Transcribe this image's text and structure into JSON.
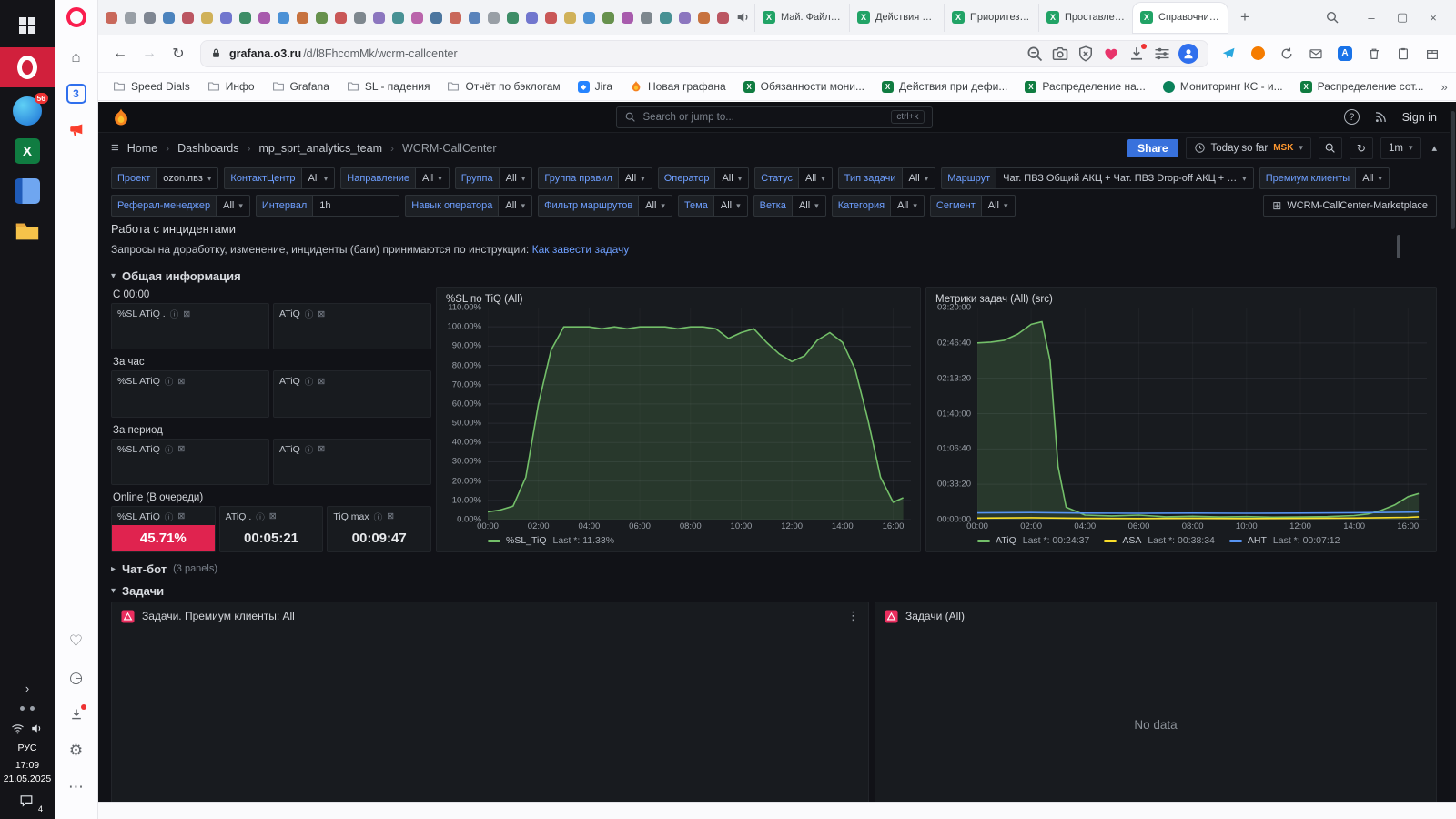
{
  "icons": {
    "chevron_down": "▾",
    "chevron_right": "▸",
    "chevron_up": "▴",
    "kebab": "⋮",
    "crumb_sep": "›",
    "plus": "+",
    "back": "←",
    "forward": "→",
    "reload": "↻",
    "menu": "≡",
    "info": "ⓘ",
    "link_box": "⊠",
    "close": "×",
    "minimize": "–",
    "maximize": "▢",
    "grid": "⊞",
    "more": "»",
    "home": "⌂",
    "heart": "♡",
    "history": "◷",
    "gear": "⚙",
    "ellipsis": "⋯",
    "doc_x": "X",
    "question": "?",
    "tray_expand": "›"
  },
  "taskbar": {
    "time": "17:09",
    "date": "21.05.2025",
    "lang": "РУС",
    "opera_badge": "56",
    "notif_count": "4"
  },
  "opera_sidebar": {
    "tab_count": "3"
  },
  "browser": {
    "pinned_tab_colors": [
      "#c24f3f",
      "#8a8f98",
      "#6b7280",
      "#2f6fb3",
      "#b23a48",
      "#caa53d",
      "#5b5fc7",
      "#1f7a4d",
      "#9b3fa0",
      "#2f7fd0",
      "#c05a1f",
      "#4f7f2f",
      "#c23b3b",
      "#6a737b",
      "#7a5fb5",
      "#2a7f82",
      "#b04a9e",
      "#2f5f8f",
      "#c24f3f",
      "#3f6fb0",
      "#8a8f98",
      "#1f7a4d",
      "#5b5fc7",
      "#c23b3b",
      "#caa53d",
      "#2f7fd0",
      "#4f7f2f",
      "#9b3fa0",
      "#6a737b",
      "#2a7f82",
      "#7a5fb5",
      "#c05a1f",
      "#b23a48"
    ],
    "tabs": [
      {
        "label": "Май. Файл мо...",
        "color": "#21a366"
      },
      {
        "label": "Действия по ...",
        "color": "#21a366"
      },
      {
        "label": "Приоритеза...",
        "color": "#21a366"
      },
      {
        "label": "Проставлени...",
        "color": "#21a366"
      },
      {
        "label": "Справочник ...",
        "color": "#21a366"
      }
    ],
    "active_tab": 4,
    "url_domain": "grafana.o3.ru",
    "url_path": "/d/l8FhcomMk/wcrm-callcenter",
    "bookmarks": [
      {
        "label": "Speed Dials",
        "icon": "folder"
      },
      {
        "label": "Инфо",
        "icon": "folder"
      },
      {
        "label": "Grafana",
        "icon": "folder"
      },
      {
        "label": "SL - падения",
        "icon": "folder"
      },
      {
        "label": "Отчёт по бэклогам",
        "icon": "folder"
      },
      {
        "label": "Jira",
        "icon": "jira"
      },
      {
        "label": "Новая графана",
        "icon": "grafana"
      },
      {
        "label": "Обязанности мони...",
        "icon": "excel"
      },
      {
        "label": "Действия при дефи...",
        "icon": "excel"
      },
      {
        "label": "Распределение на...",
        "icon": "excel"
      },
      {
        "label": "Мониторинг КС - и...",
        "icon": "sharepoint"
      },
      {
        "label": "Распределение сот...",
        "icon": "excel"
      }
    ],
    "extensions": [
      {
        "name": "telegram-extension",
        "kind": "plane",
        "color": "#2aa7de"
      },
      {
        "name": "orange-extension",
        "kind": "dot",
        "color": "#f57c00"
      },
      {
        "name": "sync-extension",
        "kind": "sync"
      },
      {
        "name": "mail-extension",
        "kind": "mail"
      },
      {
        "name": "translate-extension",
        "kind": "badge",
        "color": "#1a73e8",
        "letter": "A"
      },
      {
        "name": "trash-extension",
        "kind": "trash"
      },
      {
        "name": "notes-extension",
        "kind": "clipboard"
      },
      {
        "name": "box-extension",
        "kind": "box"
      }
    ]
  },
  "grafana": {
    "search": {
      "placeholder": "Search or jump to...",
      "shortcut": "ctrl+k"
    },
    "signin_label": "Sign in",
    "breadcrumb": [
      "Home",
      "Dashboards",
      "mp_sprt_analytics_team",
      "WCRM-CallCenter"
    ],
    "share_label": "Share",
    "time_range": "Today so far",
    "timezone": "MSK",
    "refresh": "1m",
    "filters_row1": [
      {
        "label": "Проект",
        "value": "ozon.пвз"
      },
      {
        "label": "КонтактЦентр",
        "value": "All"
      },
      {
        "label": "Направление",
        "value": "All"
      },
      {
        "label": "Группа",
        "value": "All"
      },
      {
        "label": "Группа правил",
        "value": "All"
      },
      {
        "label": "Оператор",
        "value": "All"
      },
      {
        "label": "Статус",
        "value": "All"
      },
      {
        "label": "Тип задачи",
        "value": "All"
      },
      {
        "label": "Маршрут",
        "value": "Чат. ПВЗ Общий АКЦ + Чат. ПВЗ Drop-off АКЦ + Чат. ПВЗ АПВЗ-...",
        "wide": true
      },
      {
        "label": "Премиум клиенты",
        "value": "All"
      }
    ],
    "filters_row2": [
      {
        "label": "Реферал-менеджер",
        "value": "All"
      },
      {
        "label": "Интервал",
        "value": "1h",
        "input": true
      },
      {
        "label": "Навык оператора",
        "value": "All"
      },
      {
        "label": "Фильтр маршрутов",
        "value": "All"
      },
      {
        "label": "Тема",
        "value": "All"
      },
      {
        "label": "Ветка",
        "value": "All"
      },
      {
        "label": "Категория",
        "value": "All"
      },
      {
        "label": "Сегмент",
        "value": "All"
      }
    ],
    "marketplace_label": "WCRM-CallCenter-Marketplace",
    "incident": {
      "title": "Работа с инцидентами",
      "text": "Запросы на доработку, изменение, инциденты (баги) принимаются по инструкции: ",
      "link": "Как завести задачу"
    },
    "sections": {
      "general": "Общая информация",
      "chatbot": "Чат-бот",
      "chatbot_count": "(3 panels)",
      "tasks": "Задачи"
    },
    "stat_groups": [
      {
        "title": "С 00:00",
        "stats": [
          {
            "title": "%SL ATiQ .",
            "value": ""
          },
          {
            "title": "ATiQ",
            "value": ""
          }
        ]
      },
      {
        "title": "За час",
        "stats": [
          {
            "title": "%SL ATiQ",
            "value": ""
          },
          {
            "title": "ATiQ",
            "value": ""
          }
        ]
      },
      {
        "title": "За период",
        "stats": [
          {
            "title": "%SL ATiQ",
            "value": ""
          },
          {
            "title": "ATiQ",
            "value": ""
          }
        ]
      },
      {
        "title": "Online (В очереди)",
        "stats": [
          {
            "title": "%SL ATiQ",
            "value": "45.71%",
            "bg": "#e0234f"
          },
          {
            "title": "ATiQ .",
            "value": "00:05:21"
          },
          {
            "title": "TiQ max",
            "value": "00:09:47"
          }
        ]
      }
    ],
    "panels_bottom": [
      {
        "title": "Задачи. Премиум клиенты: All",
        "body": ""
      },
      {
        "title": "Задачи (All)",
        "body": "No data"
      }
    ]
  },
  "chart_data": [
    {
      "type": "area",
      "title": "%SL по TiQ (All)",
      "xlim": [
        0,
        16.7
      ],
      "ylim": [
        0,
        110
      ],
      "yticks": [
        "110.00%",
        "100.00%",
        "90.00%",
        "80.00%",
        "70.00%",
        "60.00%",
        "50.00%",
        "40.00%",
        "30.00%",
        "20.00%",
        "10.00%",
        "0.00%"
      ],
      "xtick_hours": [
        0,
        2,
        4,
        6,
        8,
        10,
        12,
        14,
        16
      ],
      "xtick_labels": [
        "00:00",
        "02:00",
        "04:00",
        "06:00",
        "08:00",
        "10:00",
        "12:00",
        "14:00",
        "16:00"
      ],
      "series": [
        {
          "name": "%SL_TiQ",
          "color": "#73bf69",
          "fill": true,
          "x": [
            0,
            0.5,
            1,
            1.5,
            2,
            2.5,
            3,
            3.5,
            4,
            4.5,
            5,
            5.5,
            6,
            6.5,
            7,
            7.5,
            8,
            8.5,
            9,
            9.5,
            10,
            10.5,
            11,
            11.5,
            12,
            12.5,
            13,
            13.5,
            14,
            14.5,
            15,
            15.5,
            16,
            16.4
          ],
          "values": [
            4,
            5,
            7,
            22,
            60,
            88,
            100,
            100,
            100,
            99,
            100,
            99,
            100,
            100,
            100,
            99,
            100,
            100,
            99,
            94,
            97,
            99,
            92,
            86,
            82,
            85,
            93,
            97,
            92,
            78,
            52,
            22,
            9,
            11.33
          ]
        }
      ],
      "legend": [
        {
          "name": "%SL_TiQ",
          "last": "Last *: 11.33%",
          "color": "#73bf69"
        }
      ]
    },
    {
      "type": "line",
      "title": "Метрики задач (All) (src)",
      "xlim": [
        0,
        16.7
      ],
      "ylim": [
        0,
        12000
      ],
      "yticks": [
        "03:20:00",
        "02:46:40",
        "02:13:20",
        "01:40:00",
        "01:06:40",
        "00:33:20",
        "00:00:00"
      ],
      "xtick_hours": [
        0,
        2,
        4,
        6,
        8,
        10,
        12,
        14,
        16
      ],
      "xtick_labels": [
        "00:00",
        "02:00",
        "04:00",
        "06:00",
        "08:00",
        "10:00",
        "12:00",
        "14:00",
        "16:00"
      ],
      "series": [
        {
          "name": "ATiQ",
          "color": "#73bf69",
          "fill": true,
          "x": [
            0,
            0.5,
            1,
            1.5,
            2,
            2.4,
            2.7,
            3,
            3.3,
            4,
            5,
            6,
            7,
            8,
            9,
            10,
            11,
            12,
            13,
            14,
            14.5,
            15,
            15.5,
            16,
            16.4
          ],
          "values": [
            10000,
            10050,
            10150,
            10500,
            11050,
            11200,
            9000,
            3000,
            700,
            260,
            210,
            260,
            160,
            190,
            150,
            170,
            140,
            150,
            170,
            230,
            320,
            520,
            830,
            1300,
            1477
          ]
        },
        {
          "name": "ASA",
          "color": "#fade2a",
          "fill": false,
          "x": [
            0,
            2,
            4,
            6,
            8,
            10,
            12,
            14,
            16,
            16.4
          ],
          "values": [
            90,
            110,
            70,
            60,
            70,
            60,
            70,
            90,
            130,
            160
          ]
        },
        {
          "name": "AHT",
          "color": "#5794f2",
          "fill": false,
          "x": [
            0,
            2,
            4,
            6,
            8,
            10,
            12,
            14,
            16,
            16.4
          ],
          "values": [
            380,
            400,
            370,
            360,
            370,
            360,
            370,
            390,
            420,
            432
          ]
        }
      ],
      "legend": [
        {
          "name": "ATiQ",
          "last": "Last *: 00:24:37",
          "color": "#73bf69"
        },
        {
          "name": "ASA",
          "last": "Last *: 00:38:34",
          "color": "#fade2a"
        },
        {
          "name": "AHT",
          "last": "Last *: 00:07:12",
          "color": "#5794f2"
        }
      ]
    }
  ]
}
